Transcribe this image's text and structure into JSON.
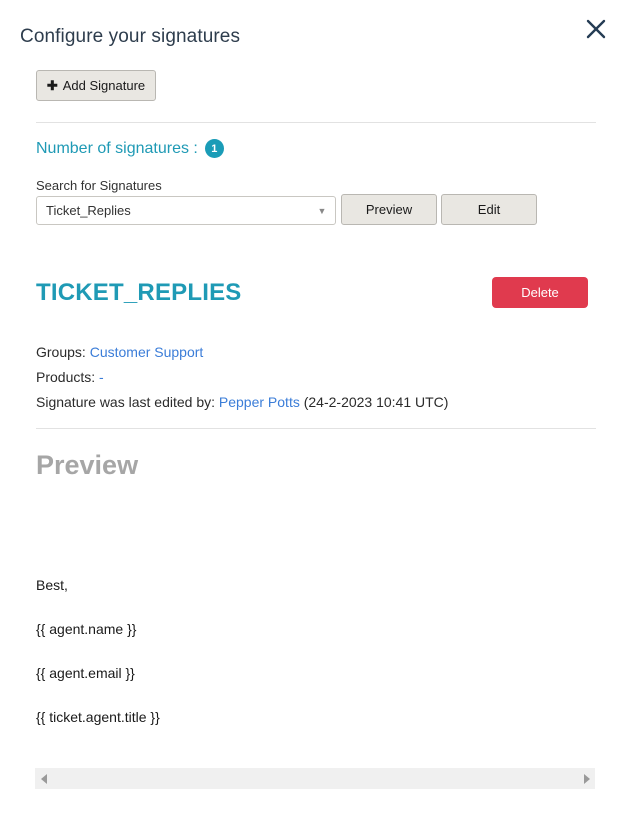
{
  "header": {
    "title": "Configure your signatures",
    "close_icon": "close-icon"
  },
  "toolbar": {
    "add_signature_label": "Add Signature",
    "plus_glyph": "✚"
  },
  "counts": {
    "label": "Number of signatures :",
    "value": "1"
  },
  "search": {
    "label": "Search for Signatures",
    "selected_value": "Ticket_Replies",
    "caret_glyph": "▼",
    "preview_button": "Preview",
    "edit_button": "Edit"
  },
  "signature": {
    "name": "TICKET_REPLIES",
    "delete_button": "Delete",
    "groups_label": "Groups:",
    "groups_value": "Customer Support",
    "products_label": "Products:",
    "products_value": "-",
    "edited_label": "Signature was last edited by:",
    "edited_by": "Pepper Potts",
    "edited_when": "(24-2-2023 10:41 UTC)"
  },
  "preview": {
    "heading": "Preview",
    "lines": [
      "Best,",
      "{{ agent.name }}",
      "{{ agent.email }}",
      "{{ ticket.agent.title }}"
    ]
  },
  "scrollbar": {
    "left_arrow_icon": "caret-left-icon",
    "right_arrow_icon": "caret-right-icon"
  },
  "colors": {
    "accent_teal": "#1f9ab5",
    "badge_teal": "#1a9cb7",
    "danger_red": "#e03a4e",
    "link_blue": "#3b7dd8",
    "title_navy": "#2e3d4d"
  }
}
